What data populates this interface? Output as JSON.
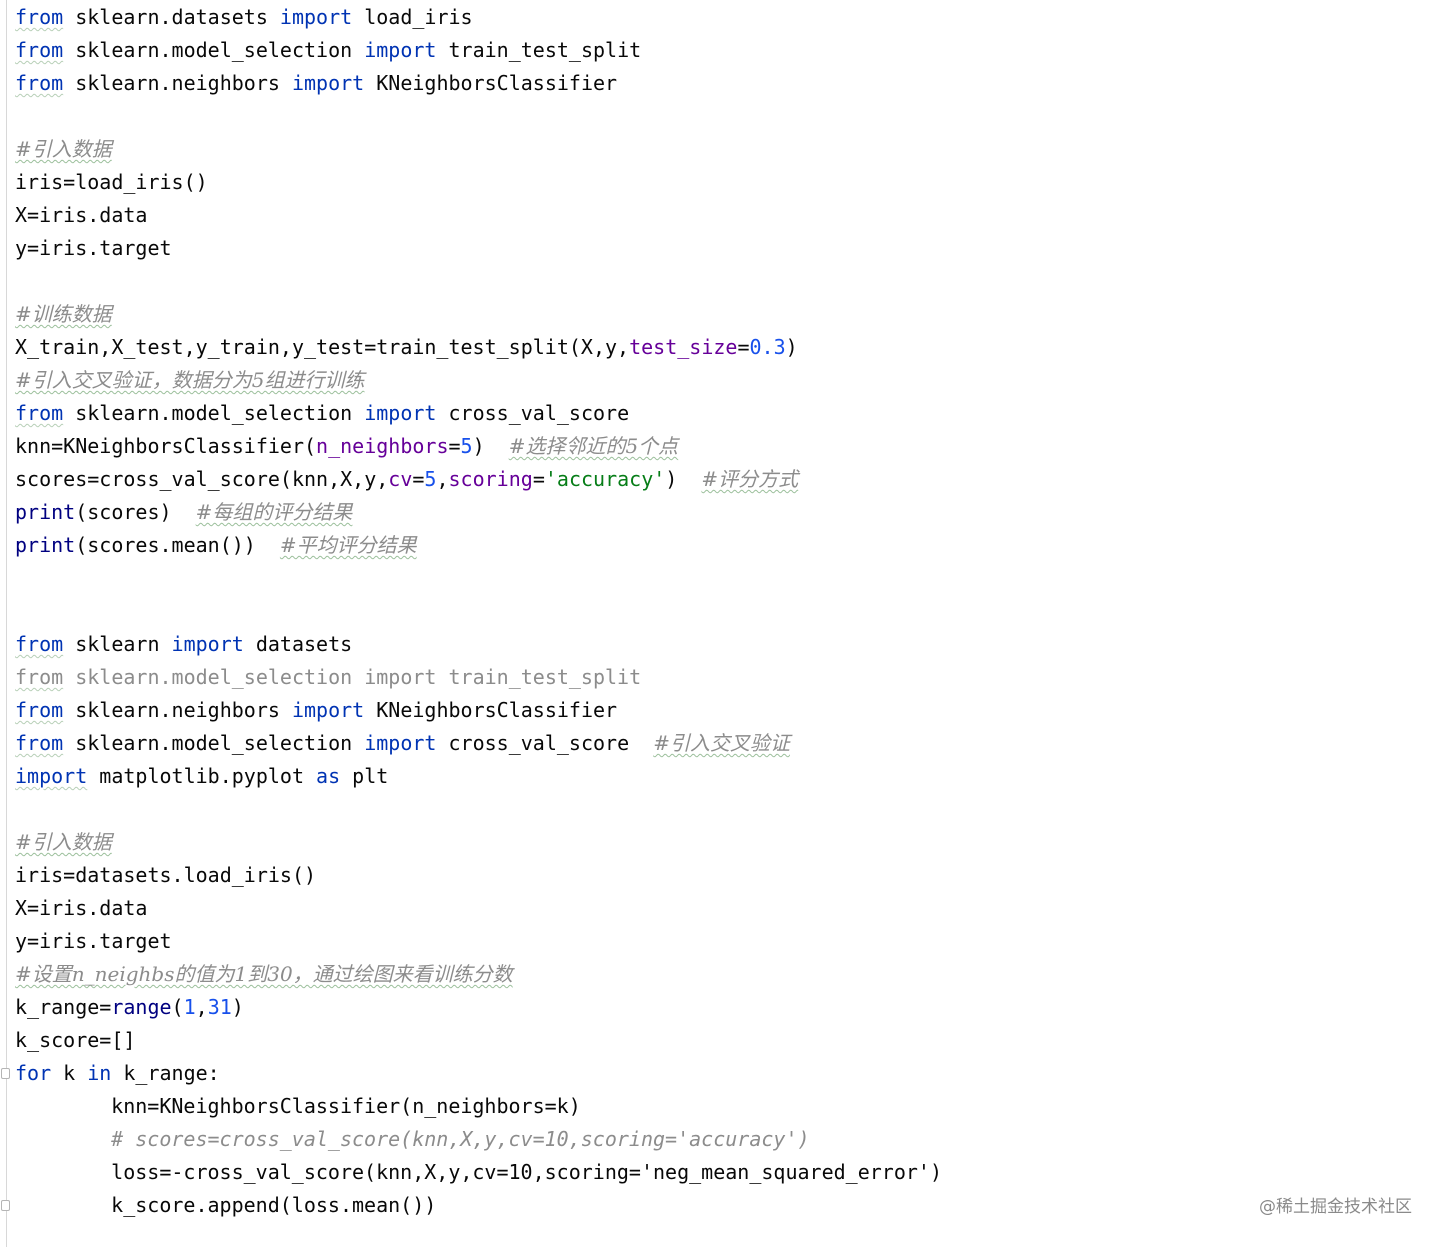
{
  "editor": {
    "lines": [
      "from sklearn.datasets import load_iris",
      "from sklearn.model_selection import train_test_split",
      "from sklearn.neighbors import KNeighborsClassifier",
      "",
      "#引入数据",
      "iris=load_iris()",
      "X=iris.data",
      "y=iris.target",
      "",
      "#训练数据",
      "X_train,X_test,y_train,y_test=train_test_split(X,y,test_size=0.3)",
      "#引入交叉验证，数据分为5组进行训练",
      "from sklearn.model_selection import cross_val_score",
      "knn=KNeighborsClassifier(n_neighbors=5)  #选择邻近的5个点",
      "scores=cross_val_score(knn,X,y,cv=5,scoring='accuracy')  #评分方式",
      "print(scores)  #每组的评分结果",
      "print(scores.mean())  #平均评分结果",
      "",
      "",
      "from sklearn import datasets",
      "from sklearn.model_selection import train_test_split",
      "from sklearn.neighbors import KNeighborsClassifier",
      "from sklearn.model_selection import cross_val_score  #引入交叉验证",
      "import matplotlib.pyplot as plt",
      "",
      "#引入数据",
      "iris=datasets.load_iris()",
      "X=iris.data",
      "y=iris.target",
      "#设置n_neighbs的值为1到30，通过绘图来看训练分数",
      "k_range=range(1,31)",
      "k_score=[]",
      "for k in k_range:",
      "    knn=KNeighborsClassifier(n_neighbors=k)",
      "    # scores=cross_val_score(knn,X,y,cv=10,scoring='accuracy')",
      "    loss=-cross_val_score(knn,X,y,cv=10,scoring='neg_mean_squared_error')",
      "    k_score.append(loss.mean())"
    ]
  },
  "watermark": "@稀土掘金技术社区"
}
